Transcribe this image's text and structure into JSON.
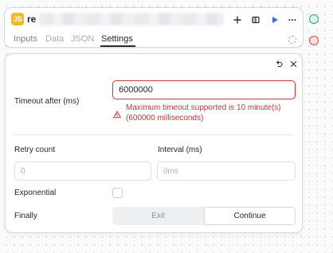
{
  "node": {
    "badge": "JS",
    "name_visible": "re",
    "icons": [
      "plus-icon",
      "split-icon",
      "play-icon",
      "more-icon"
    ],
    "tabs": [
      {
        "label": "Inputs",
        "state": "enabled"
      },
      {
        "label": "Data",
        "state": "disabled"
      },
      {
        "label": "JSON",
        "state": "disabled"
      },
      {
        "label": "Settings",
        "state": "active"
      }
    ]
  },
  "panel": {
    "icons": [
      "undo-icon",
      "close-icon"
    ],
    "timeout": {
      "label": "Timeout after (ms)",
      "value": "6000000",
      "error": "Maximum timeout supported is 10 minute(s) (600000 milliseconds)"
    },
    "retry_count": {
      "label": "Retry count",
      "placeholder": "0"
    },
    "interval": {
      "label": "Interval (ms)",
      "placeholder": "0ms"
    },
    "exponential": {
      "label": "Exponential",
      "checked": false
    },
    "finally": {
      "label": "Finally",
      "options": [
        "Exit",
        "Continue"
      ],
      "selected": "Continue"
    }
  },
  "colors": {
    "accent": "#2f6fe4",
    "error": "#c23a3a",
    "success_handle": "#2fa766",
    "error_handle": "#d94a4a",
    "js_badge": "#f6b82b"
  }
}
